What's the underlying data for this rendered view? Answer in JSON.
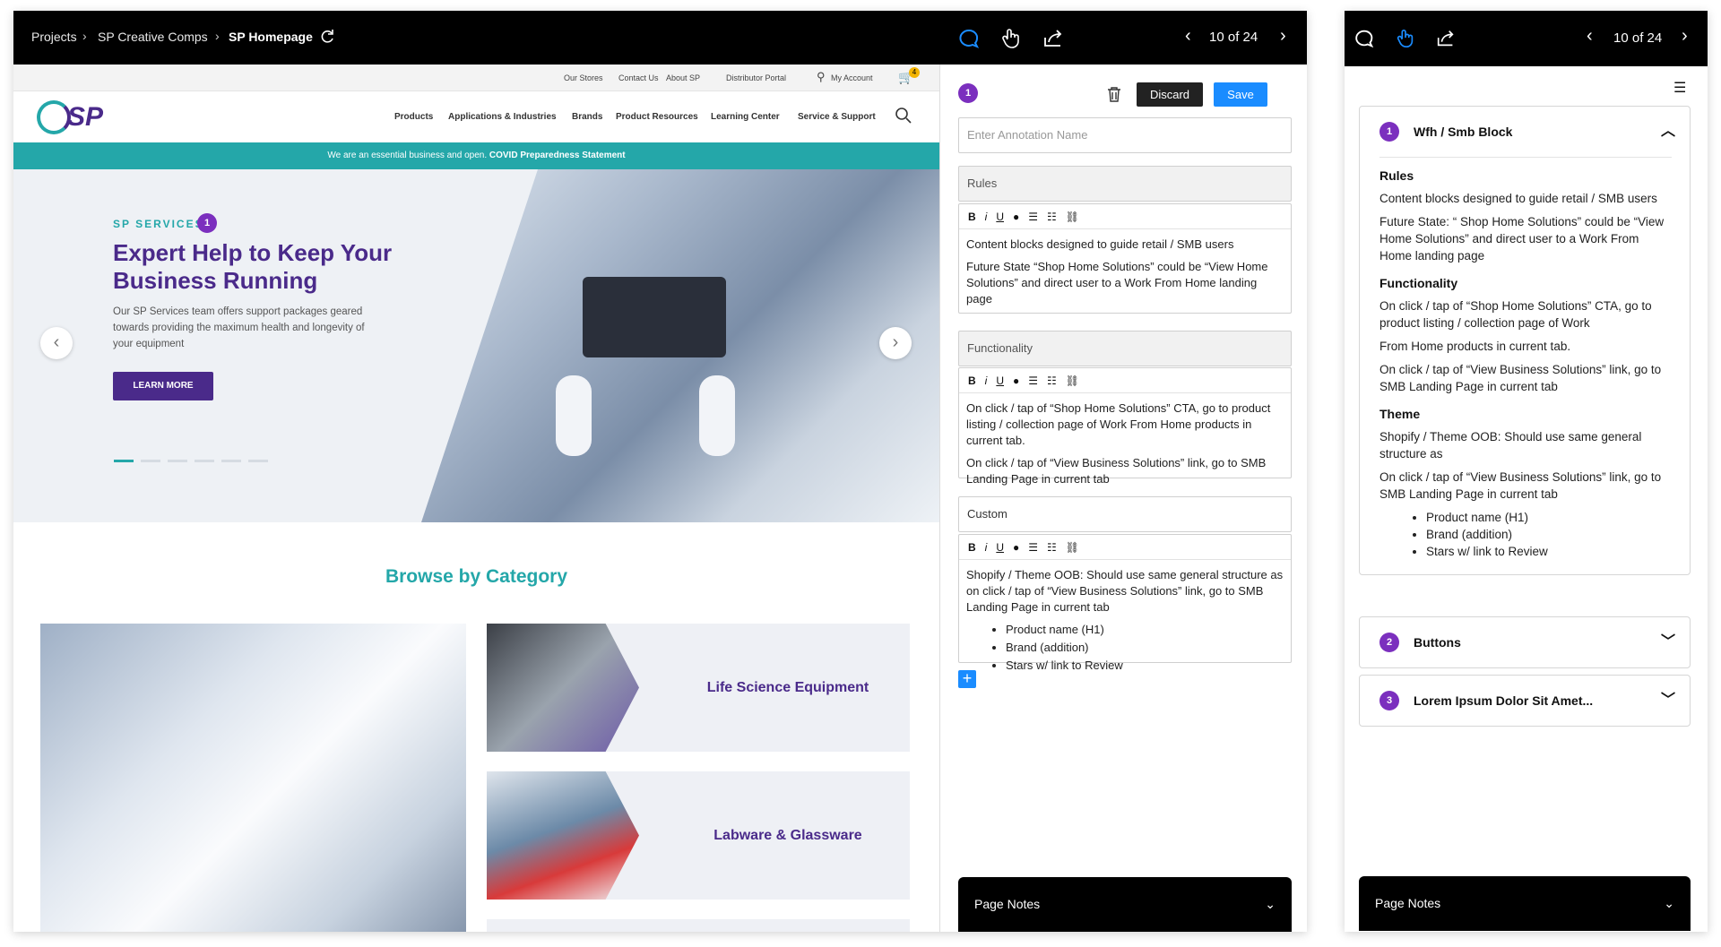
{
  "topbar": {
    "breadcrumb": [
      "Projects",
      "SP Creative Comps",
      "SP Homepage"
    ],
    "page_counter": "10 of 24"
  },
  "site": {
    "util_links": [
      "Our Stores",
      "Contact Us",
      "About SP",
      "Distributor Portal",
      "My Account"
    ],
    "cart_count": "4",
    "logo": "SP",
    "nav": [
      "Products",
      "Applications & Industries",
      "Brands",
      "Product Resources",
      "Learning Center",
      "Service & Support"
    ],
    "covid_text": "We are an essential business and open.",
    "covid_link": "COVID Preparedness Statement",
    "hero": {
      "eyebrow": "SP SERVICES",
      "badge": "1",
      "title": "Expert Help to Keep Your Business Running",
      "desc": "Our SP Services team offers support packages geared towards providing the maximum health and longevity of your equipment",
      "cta": "LEARN MORE"
    },
    "browse_title": "Browse by Category",
    "categories": [
      "Life Science Equipment",
      "Labware & Glassware"
    ]
  },
  "editor": {
    "badge": "1",
    "discard": "Discard",
    "save": "Save",
    "name_placeholder": "Enter Annotation Name",
    "rules_label": "Rules",
    "rules_p1": "Content blocks designed to guide retail / SMB users",
    "rules_p2": "Future State “Shop Home Solutions” could be “View Home Solutions” and direct user to a Work From Home landing page",
    "functionality_label": "Functionality",
    "func_p1": "On click / tap of “Shop Home Solutions” CTA, go to product listing / collection page of Work From Home products in current tab.",
    "func_p2": "On click / tap of “View Business Solutions” link, go to SMB Landing Page in current tab",
    "custom_label": "Custom",
    "custom_p1": "Shopify / Theme OOB: Should use same general structure as on click / tap of “View Business Solutions” link, go to SMB Landing Page in current tab",
    "custom_list": [
      "Product name (H1)",
      "Brand (addition)",
      "Stars w/ link to Review"
    ],
    "toolbar": [
      "B",
      "i",
      "U"
    ],
    "page_notes": "Page Notes"
  },
  "right": {
    "page_counter": "10 of 24",
    "acc1": {
      "num": "1",
      "title": "Wfh / Smb Block",
      "rules_h": "Rules",
      "rules_p1": "Content blocks designed to guide retail / SMB users",
      "rules_p2": "Future State: “ Shop Home Solutions” could be “View Home Solutions” and direct user to a Work From Home landing page",
      "func_h": "Functionality",
      "func_p1": "On click / tap of “Shop Home Solutions” CTA, go to product listing / collection page of Work",
      "func_p2": "From Home products in current tab.",
      "func_p3": "On click / tap of “View Business Solutions” link, go to SMB Landing Page in current tab",
      "theme_h": "Theme",
      "theme_p1": "Shopify / Theme OOB: Should use same general structure as",
      "theme_p2": "On click / tap of “View Business Solutions” link, go to SMB Landing Page in current tab",
      "theme_list": [
        "Product name (H1)",
        "Brand (addition)",
        "Stars w/ link to Review"
      ]
    },
    "acc2": {
      "num": "2",
      "title": "Buttons"
    },
    "acc3": {
      "num": "3",
      "title": "Lorem Ipsum Dolor Sit Amet..."
    },
    "page_notes": "Page Notes"
  },
  "colors": {
    "accent_blue": "#1a8cff",
    "teal": "#24a7a9",
    "purple": "#4a2a8a",
    "badge_purple": "#7b2fbe"
  },
  "icons": [
    "comment-icon",
    "hand-pointer-icon",
    "share-icon",
    "chevron-left-icon",
    "chevron-right-icon",
    "refresh-icon",
    "trash-icon",
    "menu-icon",
    "search-icon",
    "cart-icon",
    "user-icon"
  ]
}
